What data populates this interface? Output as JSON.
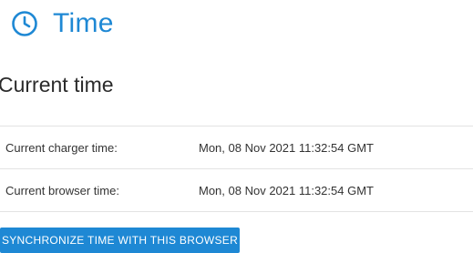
{
  "header": {
    "icon": "clock-icon",
    "title": "Time",
    "accent_color": "#1e88d4"
  },
  "section": {
    "title": "Current time"
  },
  "rows": [
    {
      "label": "Current charger time:",
      "value": "Mon, 08 Nov 2021 11:32:54 GMT"
    },
    {
      "label": "Current browser time:",
      "value": "Mon, 08 Nov 2021 11:32:54 GMT"
    }
  ],
  "actions": {
    "sync_label": "SYNCHRONIZE TIME WITH THIS BROWSER"
  }
}
